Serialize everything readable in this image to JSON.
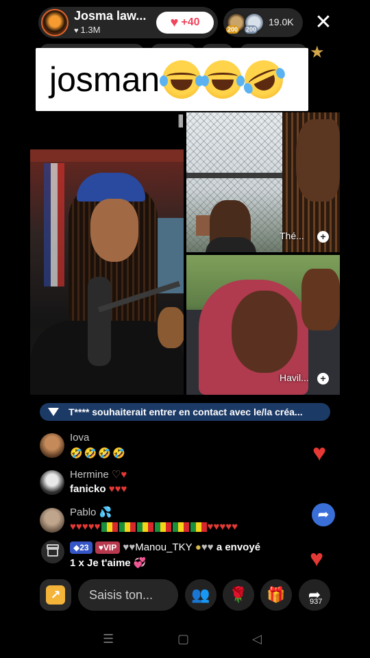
{
  "host": {
    "name": "Josma law...",
    "likes": "1.3M",
    "follow_count": "+40"
  },
  "viewers": {
    "ranks": [
      "200",
      "200"
    ],
    "count": "19.0K"
  },
  "caption": {
    "text": "josman"
  },
  "guests": [
    {
      "label": "Thé..."
    },
    {
      "label": "Havil..."
    }
  ],
  "notice": {
    "text": "T**** souhaiterait entrer en contact avec le/la créa..."
  },
  "chat": [
    {
      "name": "Iova",
      "message": "🤣🤣🤣🤣"
    },
    {
      "name": "Hermine",
      "message": "fanicko"
    },
    {
      "name": "Pablo",
      "message": ""
    }
  ],
  "gift_message": {
    "level": "23",
    "vip": "VIP",
    "sender": "Manou_TKY",
    "action": "a envoyé",
    "gift": "1 x Je t'aime"
  },
  "input": {
    "placeholder": "Saisis ton..."
  },
  "share_count": "937",
  "colors": {
    "notice_bg": "#1c3a66",
    "follow_heart": "#f0435c",
    "heart": "#e53935"
  },
  "icons": [
    "close-icon",
    "star-icon",
    "heart-icon",
    "gift-icon",
    "rose-icon",
    "share-icon",
    "guests-icon",
    "plus-icon"
  ]
}
